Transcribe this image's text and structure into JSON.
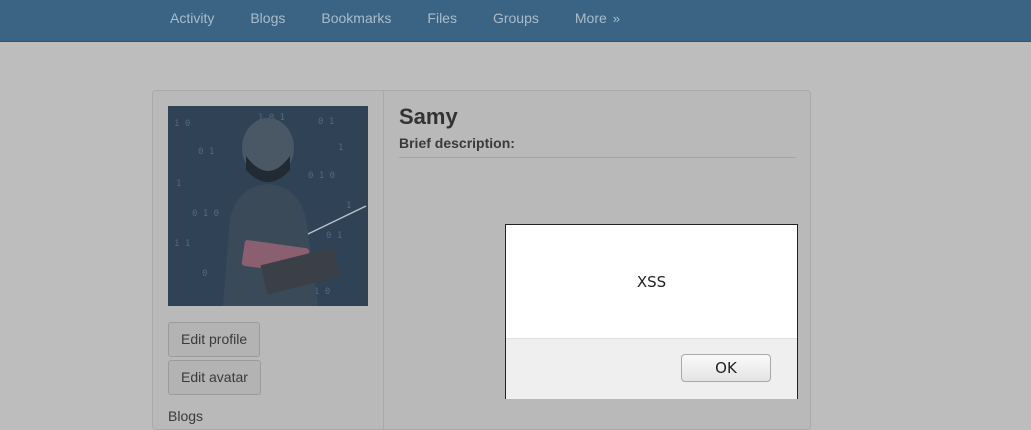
{
  "nav": {
    "items": [
      "Activity",
      "Blogs",
      "Bookmarks",
      "Files",
      "Groups"
    ],
    "more_label": "More",
    "more_chevron": "»"
  },
  "profile": {
    "name": "Samy",
    "brief_description_label": "Brief description:",
    "edit_profile_label": "Edit profile",
    "edit_avatar_label": "Edit avatar",
    "blogs_link_label": "Blogs"
  },
  "alert": {
    "message": "XSS",
    "ok_label": "OK"
  }
}
